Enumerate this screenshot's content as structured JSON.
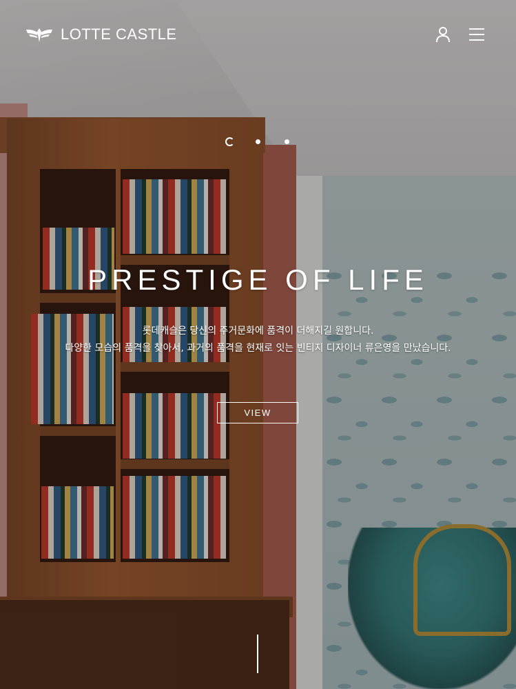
{
  "header": {
    "brand": "LOTTE CASTLE",
    "logo_icon": "eagle-emblem-icon",
    "user_icon": "user-icon",
    "menu_icon": "hamburger-menu-icon"
  },
  "slider": {
    "indicators": [
      "loading-indicator",
      "dot-indicator",
      "dot-indicator"
    ]
  },
  "hero": {
    "title": "PRESTIGE OF LIFE",
    "desc_line1": "롯데캐슬은 당신의 주거문화에 품격이 더해지길 원합니다.",
    "desc_line2": "다양한 모습의 품격을 찾아서, 과거의 품격을 현재로 잇는 빈티지 디자이너 류은영을 만났습니다.",
    "button_label": "VIEW"
  },
  "colors": {
    "text": "#ffffff",
    "overlay": "rgba(20,12,8,0.28)"
  }
}
